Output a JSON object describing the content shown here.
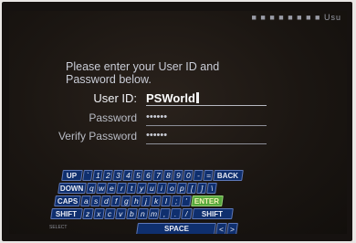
{
  "status": {
    "indicator": "■ ■ ■ ■ ■ ■ ■ ■ Usu"
  },
  "login": {
    "instruction": "Please enter your User ID and\nPassword below.",
    "user_id_label": "User ID:",
    "user_id_value": "PSWorld",
    "password_label": "Password",
    "password_value": "••••••",
    "verify_label": "Verify Password",
    "verify_value": "••••••"
  },
  "keyboard": {
    "rows": [
      [
        "UP",
        "`",
        "1",
        "2",
        "3",
        "4",
        "5",
        "6",
        "7",
        "8",
        "9",
        "0",
        "-",
        "=",
        "BACK"
      ],
      [
        "DOWN",
        "q",
        "w",
        "e",
        "r",
        "t",
        "y",
        "u",
        "i",
        "o",
        "p",
        "[",
        "]",
        "\\"
      ],
      [
        "CAPS",
        "a",
        "s",
        "d",
        "f",
        "g",
        "h",
        "j",
        "k",
        "l",
        ";",
        "'",
        "ENTER"
      ],
      [
        "SHIFT",
        "z",
        "x",
        "c",
        "v",
        "b",
        "n",
        "m",
        ",",
        ".",
        "/",
        "SHIFT"
      ],
      [
        "SPACE",
        "<",
        ">"
      ]
    ]
  },
  "misc": {
    "small_label": "SELECT"
  }
}
